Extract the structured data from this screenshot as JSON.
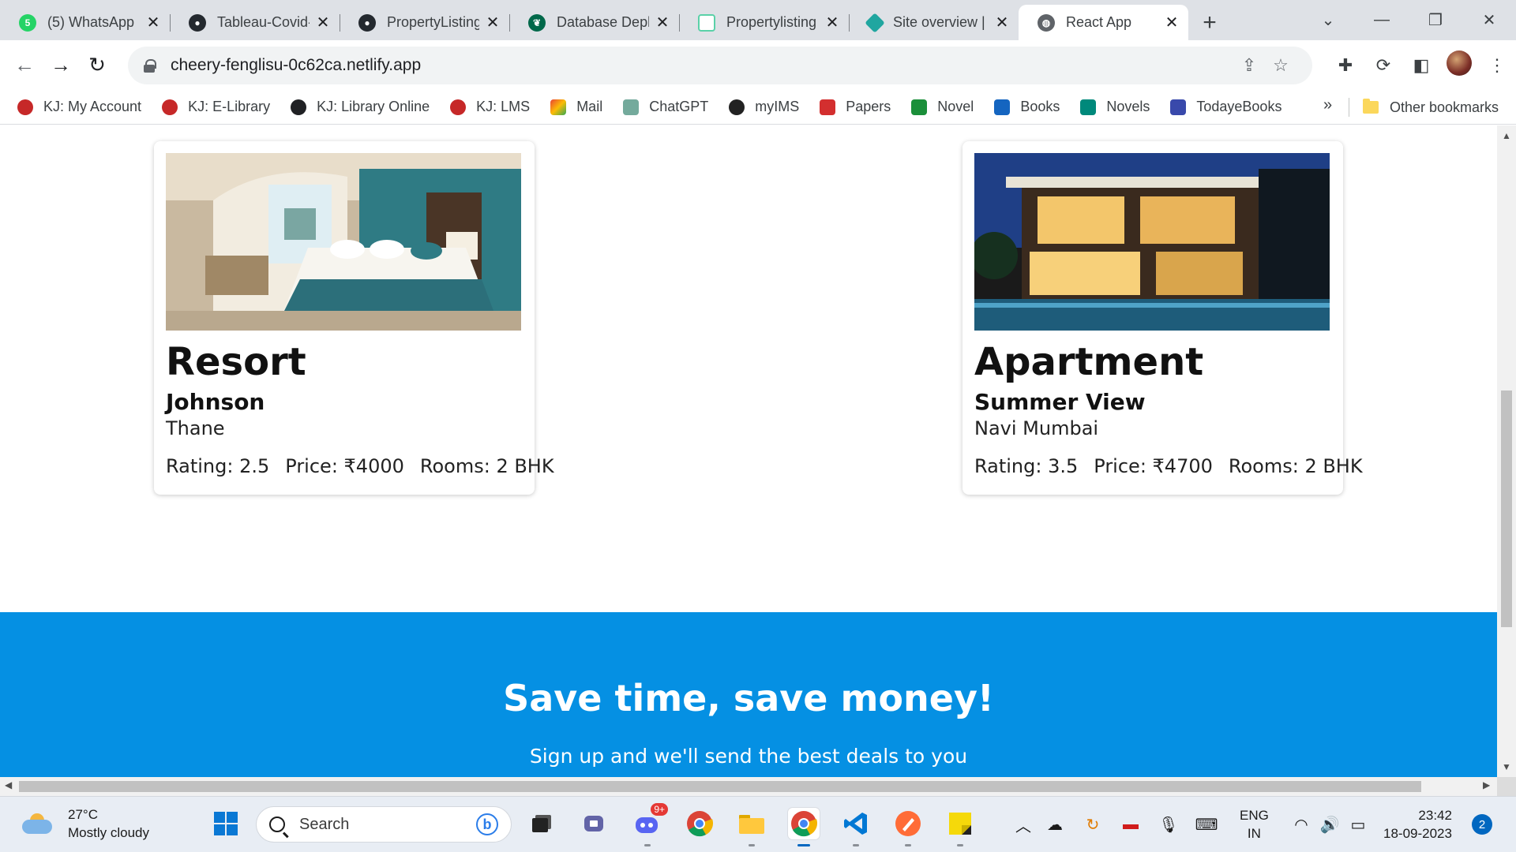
{
  "browser": {
    "tabs": [
      {
        "title": "(5) WhatsApp",
        "favicon": "whatsapp-icon",
        "color": "#25d366",
        "badge": "5"
      },
      {
        "title": "Tableau-Covid-",
        "favicon": "github-icon",
        "color": "#24292f"
      },
      {
        "title": "PropertyListing",
        "favicon": "github-icon",
        "color": "#24292f"
      },
      {
        "title": "Database Depl",
        "favicon": "mongodb-icon",
        "color": "#00684a"
      },
      {
        "title": "Propertylisting",
        "favicon": "page-icon",
        "color": "#5ad1a8"
      },
      {
        "title": "Site overview |",
        "favicon": "netlify-icon",
        "color": "#20a6a0"
      },
      {
        "title": "React App",
        "favicon": "globe-icon",
        "color": "#5f6368",
        "active": true
      }
    ],
    "url": "cheery-fenglisu-0c62ca.netlify.app",
    "bookmarks": [
      {
        "label": "KJ: My Account",
        "icon": "kj-icon",
        "color": "#c62828"
      },
      {
        "label": "KJ: E-Library",
        "icon": "kj-icon",
        "color": "#c62828"
      },
      {
        "label": "KJ: Library Online",
        "icon": "globe-icon",
        "color": "#202124"
      },
      {
        "label": "KJ: LMS",
        "icon": "kj-icon",
        "color": "#c62828"
      },
      {
        "label": "Mail",
        "icon": "gmail-icon",
        "color": "#ea4335"
      },
      {
        "label": "ChatGPT",
        "icon": "chatgpt-icon",
        "color": "#74aa9c"
      },
      {
        "label": "myIMS",
        "icon": "ims-icon",
        "color": "#222222"
      },
      {
        "label": "Papers",
        "icon": "papers-icon",
        "color": "#d32f2f"
      },
      {
        "label": "Novel",
        "icon": "novel-icon",
        "color": "#1b8f3a"
      },
      {
        "label": "Books",
        "icon": "books-icon",
        "color": "#1565c0"
      },
      {
        "label": "Novels",
        "icon": "novels-icon",
        "color": "#00897b"
      },
      {
        "label": "TodayeBooks",
        "icon": "todayebooks-icon",
        "color": "#3949ab"
      }
    ],
    "bookmarks_more": "»",
    "other_bookmarks": "Other bookmarks"
  },
  "page": {
    "cards": [
      {
        "type": "Resort",
        "name": "Johnson",
        "city": "Thane",
        "rating": "Rating: 2.5",
        "price": "Price: ₹4000",
        "rooms": "Rooms: 2 BHK",
        "image": "resort-bedroom-photo"
      },
      {
        "type": "Apartment",
        "name": "Summer View",
        "city": "Navi Mumbai",
        "rating": "Rating: 3.5",
        "price": "Price: ₹4700",
        "rooms": "Rooms: 2 BHK",
        "image": "modern-house-night-photo"
      }
    ],
    "cta": {
      "title": "Save time, save money!",
      "subtitle": "Sign up and we'll send the best deals to you",
      "background": "#0590e3"
    }
  },
  "taskbar": {
    "weather_temp": "27°C",
    "weather_desc": "Mostly cloudy",
    "search_placeholder": "Search",
    "discord_badge": "9+",
    "lang_top": "ENG",
    "lang_bottom": "IN",
    "time": "23:42",
    "date": "18-09-2023",
    "notifications": "2"
  }
}
